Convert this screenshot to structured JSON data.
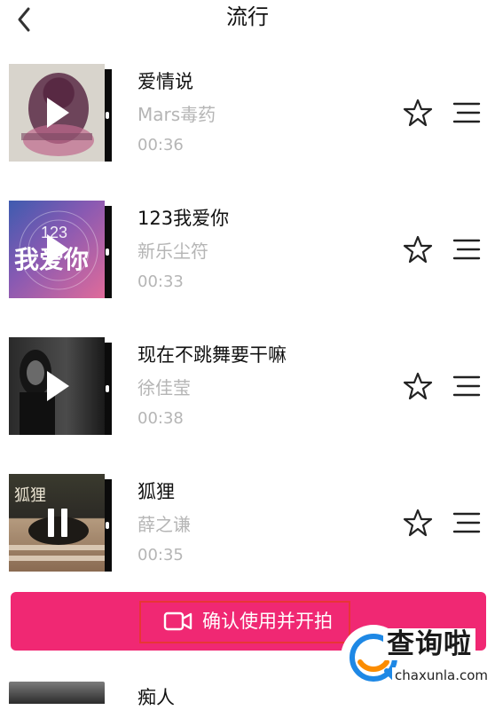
{
  "header": {
    "title": "流行",
    "back_icon": "chevron-left-icon"
  },
  "songs": [
    {
      "title": "爱情说",
      "artist": "Mars毒药",
      "duration": "00:36",
      "state": "play"
    },
    {
      "title": "123我爱你",
      "artist": "新乐尘符",
      "duration": "00:33",
      "state": "play",
      "cover_text": "我爱你",
      "cover_badge": "123"
    },
    {
      "title": "现在不跳舞要干嘛",
      "artist": "徐佳莹",
      "duration": "00:38",
      "state": "play"
    },
    {
      "title": "狐狸",
      "artist": "薛之谦",
      "duration": "00:35",
      "state": "pause",
      "cover_text": "狐狸"
    }
  ],
  "confirm": {
    "label": "确认使用并开拍",
    "icon": "video-camera-icon",
    "color": "#f02873"
  },
  "partial_song": {
    "title": "痴人"
  },
  "watermark": {
    "title": "查询啦",
    "domain": "chaxunla.com"
  },
  "colors": {
    "accent": "#f02873",
    "muted_text": "#b5b5b5",
    "highlight": "#e83535"
  }
}
